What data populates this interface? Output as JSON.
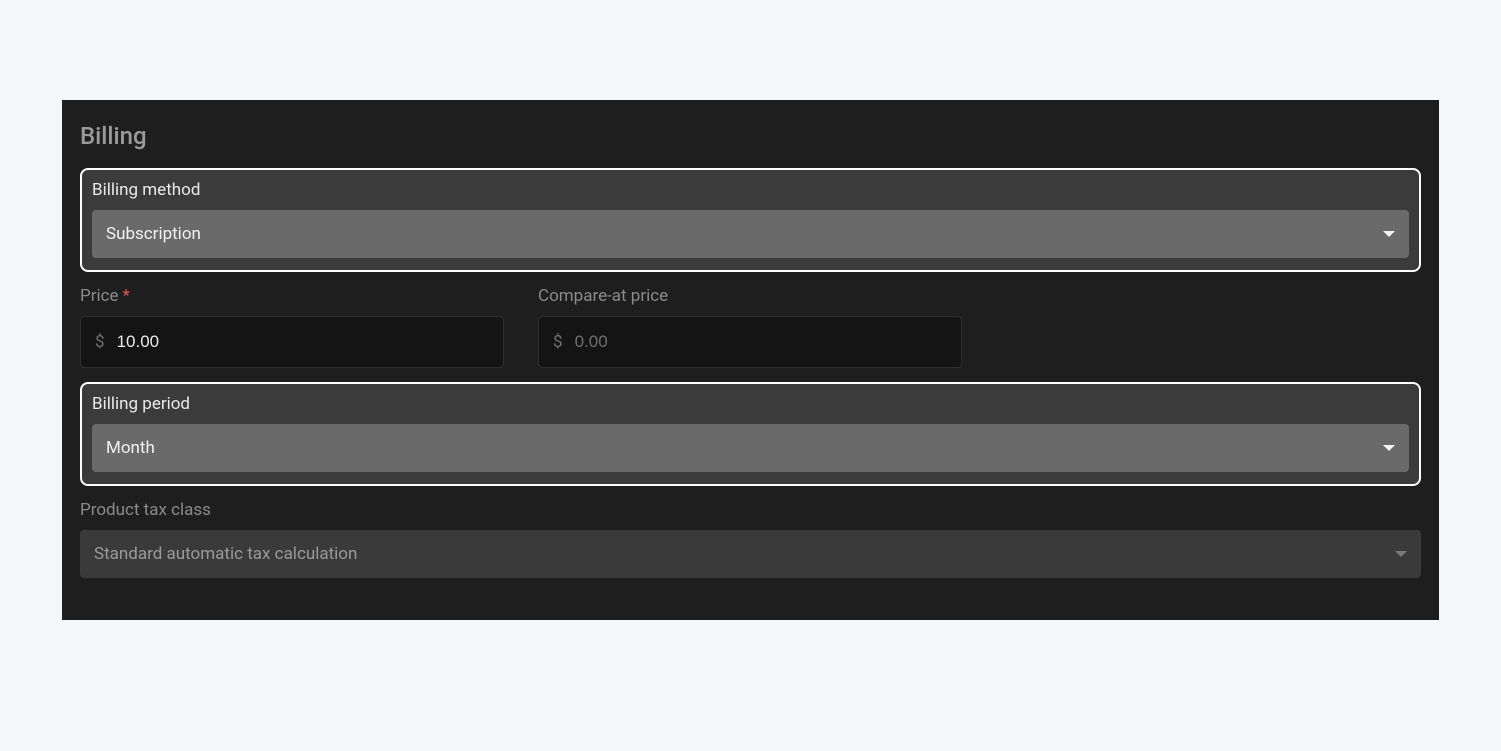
{
  "panel": {
    "title": "Billing"
  },
  "billing_method": {
    "label": "Billing method",
    "value": "Subscription"
  },
  "price": {
    "label": "Price",
    "required_mark": "*",
    "currency": "$",
    "value": "10.00"
  },
  "compare": {
    "label": "Compare-at price",
    "currency": "$",
    "placeholder": "0.00",
    "value": ""
  },
  "billing_period": {
    "label": "Billing period",
    "value": "Month"
  },
  "tax_class": {
    "label": "Product tax class",
    "value": "Standard automatic tax calculation"
  }
}
